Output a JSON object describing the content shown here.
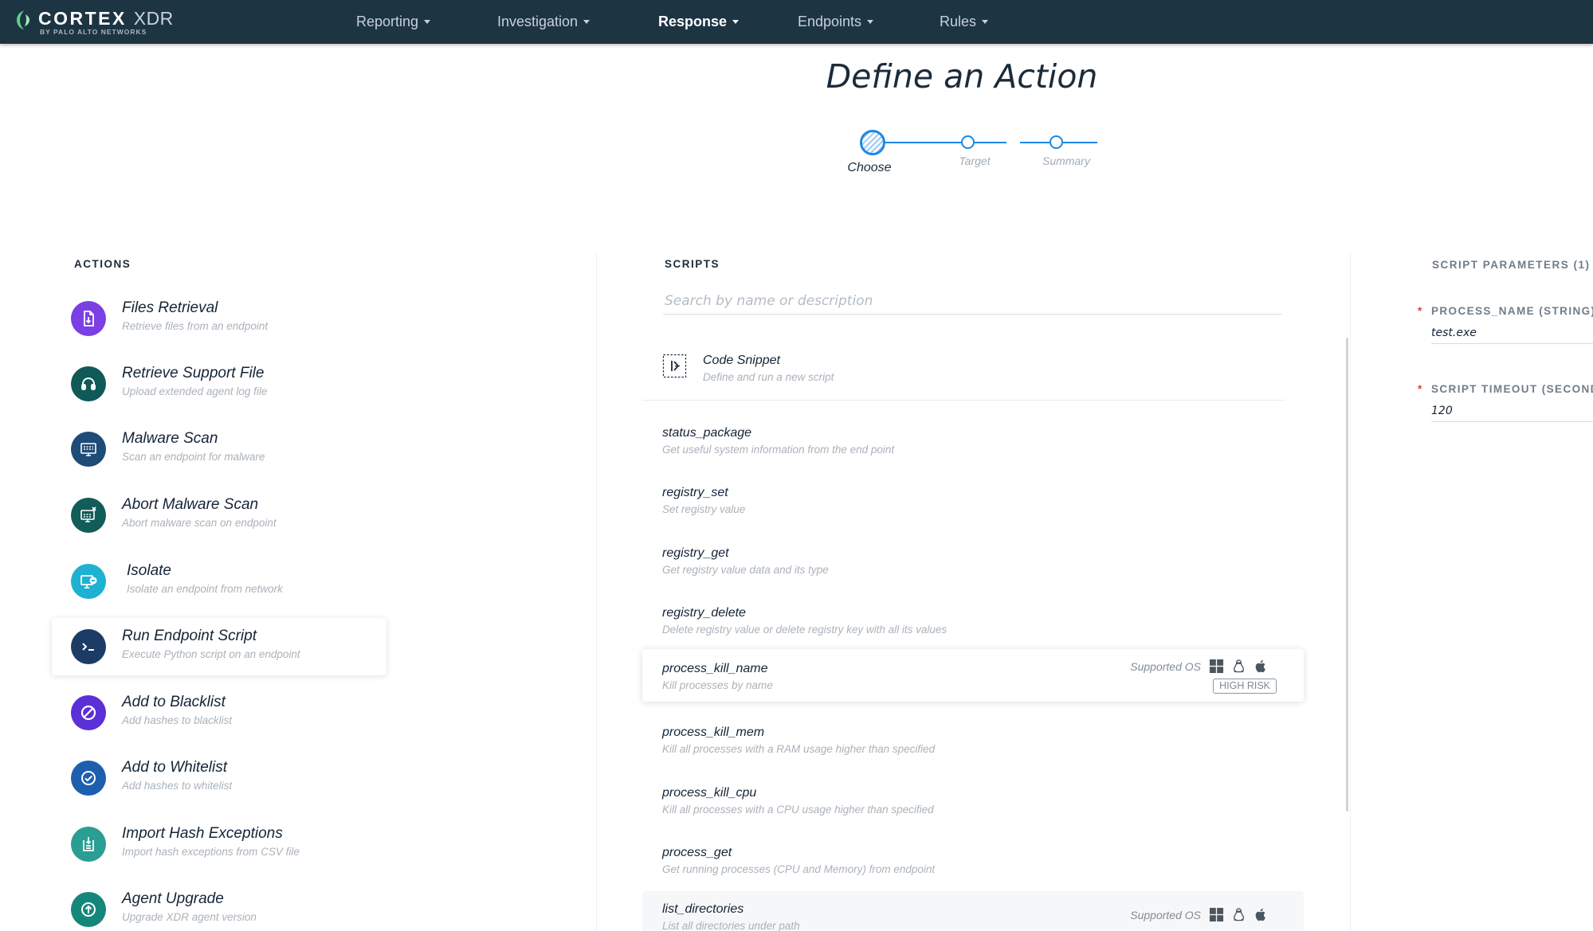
{
  "brand": {
    "name": "CORTEX",
    "product": "XDR",
    "byline": "BY PALO ALTO NETWORKS"
  },
  "nav": {
    "items": [
      {
        "label": "Reporting"
      },
      {
        "label": "Investigation"
      },
      {
        "label": "Response"
      },
      {
        "label": "Endpoints"
      },
      {
        "label": "Rules"
      }
    ],
    "active": "Response"
  },
  "page": {
    "title": "Define an Action"
  },
  "stepper": {
    "steps": [
      "Choose",
      "Target",
      "Summary"
    ],
    "current": 0
  },
  "actions": {
    "header": "ACTIONS",
    "items": [
      {
        "title": "Files Retrieval",
        "subtitle": "Retrieve files from an endpoint",
        "icon": "file-download-icon",
        "color": "#7b3fe4"
      },
      {
        "title": "Retrieve Support File",
        "subtitle": "Upload extended agent log file",
        "icon": "headset-icon",
        "color": "#0f5a56"
      },
      {
        "title": "Malware Scan",
        "subtitle": "Scan an endpoint for malware",
        "icon": "monitor-scan-icon",
        "color": "#1e4c78"
      },
      {
        "title": "Abort Malware Scan",
        "subtitle": "Abort malware scan on endpoint",
        "icon": "monitor-abort-icon",
        "color": "#125c5a"
      },
      {
        "title": "Isolate",
        "subtitle": "Isolate an endpoint from network",
        "icon": "isolate-icon",
        "color": "#1fb1d1"
      },
      {
        "title": "Run Endpoint Script",
        "subtitle": "Execute Python script on an endpoint",
        "icon": "terminal-icon",
        "color": "#1c3c66",
        "selected": true
      },
      {
        "title": "Add to Blacklist",
        "subtitle": "Add hashes to blacklist",
        "icon": "block-icon",
        "color": "#5b30d6"
      },
      {
        "title": "Add to Whitelist",
        "subtitle": "Add hashes to whitelist",
        "icon": "check-circle-icon",
        "color": "#1d5fae"
      },
      {
        "title": "Import Hash Exceptions",
        "subtitle": "Import hash exceptions from CSV file",
        "icon": "import-icon",
        "color": "#2a9e93"
      },
      {
        "title": "Agent Upgrade",
        "subtitle": "Upgrade XDR agent version",
        "icon": "upgrade-icon",
        "color": "#15877a"
      }
    ]
  },
  "scripts": {
    "header": "SCRIPTS",
    "search_placeholder": "Search by name or description",
    "code_snippet": {
      "title": "Code Snippet",
      "subtitle": "Define and run a new script",
      "icon": "code-snippet-icon"
    },
    "items": [
      {
        "title": "status_package",
        "subtitle": "Get useful system information from the end point"
      },
      {
        "title": "registry_set",
        "subtitle": "Set registry value"
      },
      {
        "title": "registry_get",
        "subtitle": "Get registry value data and its type"
      },
      {
        "title": "registry_delete",
        "subtitle": "Delete registry value or delete registry key with all its values"
      },
      {
        "title": "process_kill_name",
        "subtitle": "Kill processes by name",
        "supported_os_label": "Supported OS",
        "os_icons": [
          "windows-icon",
          "linux-icon",
          "apple-icon"
        ],
        "badge": "HIGH RISK",
        "highlight": true
      },
      {
        "title": "process_kill_mem",
        "subtitle": "Kill all processes with a RAM usage higher than specified"
      },
      {
        "title": "process_kill_cpu",
        "subtitle": "Kill all processes with a CPU usage higher than specified"
      },
      {
        "title": "process_get",
        "subtitle": "Get running processes (CPU and Memory) from endpoint"
      },
      {
        "title": "list_directories",
        "subtitle": "List all directories under path",
        "supported_os_label": "Supported OS",
        "os_icons": [
          "windows-icon",
          "linux-icon",
          "apple-icon"
        ]
      }
    ]
  },
  "parameters": {
    "header": "SCRIPT PARAMETERS (1)",
    "items": [
      {
        "label": "PROCESS_NAME (STRING)",
        "value": "test.exe",
        "required": true
      },
      {
        "label": "SCRIPT TIMEOUT (SECONDS)",
        "value": "120",
        "required": true
      }
    ]
  },
  "colors": {
    "topbar": "#1d3443",
    "accent": "#1e88e5",
    "required": "#e23a3a",
    "logo_green": "#5fd08a"
  }
}
